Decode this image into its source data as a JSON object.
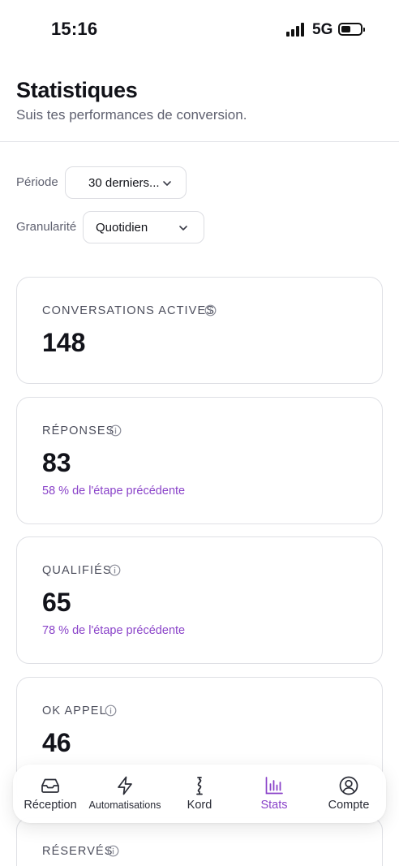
{
  "status_bar": {
    "time": "15:16",
    "network": "5G"
  },
  "header": {
    "title": "Statistiques",
    "subtitle": "Suis tes performances de conversion."
  },
  "filters": {
    "period": {
      "label": "Période",
      "value": "30 derniers..."
    },
    "granularity": {
      "label": "Granularité",
      "value": "Quotidien"
    }
  },
  "cards": [
    {
      "label": "CONVERSATIONS ACTIVES",
      "value": "148",
      "note": ""
    },
    {
      "label": "RÉPONSES",
      "value": "83",
      "note": "58 % de l'étape précédente"
    },
    {
      "label": "QUALIFIÉS",
      "value": "65",
      "note": "78 % de l'étape précédente"
    },
    {
      "label": "OK APPEL",
      "value": "46",
      "note": ""
    },
    {
      "label": "RÉSERVÉS",
      "value": "",
      "note": ""
    }
  ],
  "tabbar": {
    "items": [
      {
        "label": "Réception",
        "icon": "inbox-icon",
        "active": false
      },
      {
        "label": "Automatisations",
        "icon": "lightning-icon",
        "active": false
      },
      {
        "label": "Kord",
        "icon": "kord-logo-icon",
        "active": false
      },
      {
        "label": "Stats",
        "icon": "bar-chart-icon",
        "active": true
      },
      {
        "label": "Compte",
        "icon": "user-circle-icon",
        "active": false
      }
    ]
  },
  "colors": {
    "accent": "#8a43c9",
    "text_primary": "#111218",
    "text_secondary": "#5f6170",
    "border": "#dfe0e5"
  }
}
